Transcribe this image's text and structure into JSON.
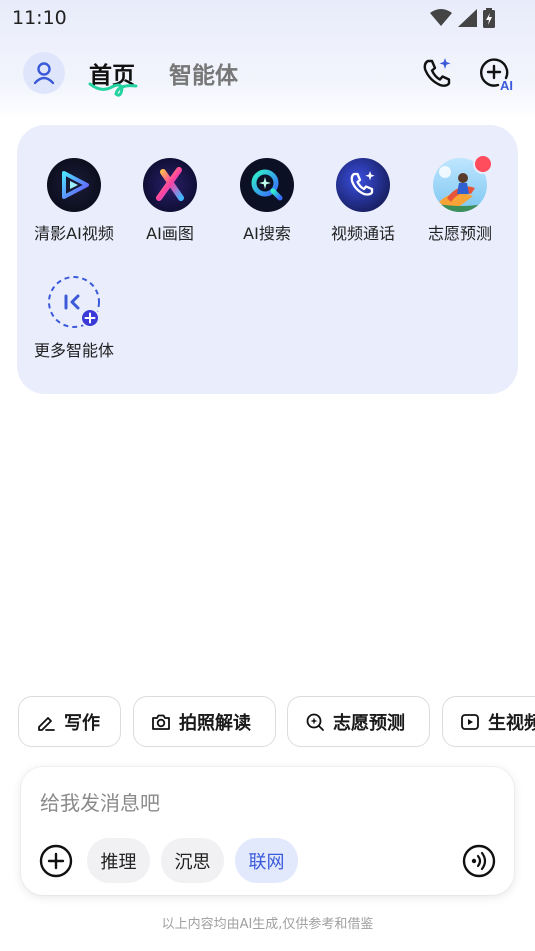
{
  "status_bar": {
    "time": "11:10"
  },
  "header": {
    "tab_home": "首页",
    "tab_agents": "智能体"
  },
  "agents": [
    {
      "label": "清影AI视频"
    },
    {
      "label": "AI画图"
    },
    {
      "label": "AI搜索"
    },
    {
      "label": "视频通话"
    },
    {
      "label": "志愿预测"
    },
    {
      "label": "更多智能体"
    }
  ],
  "chips": [
    {
      "label": "写作",
      "icon": "pen-icon"
    },
    {
      "label": "拍照解读",
      "icon": "camera-icon"
    },
    {
      "label": "志愿预测",
      "icon": "sparkle-search-icon"
    },
    {
      "label": "生视频",
      "icon": "play-icon"
    }
  ],
  "composer": {
    "placeholder": "给我发消息吧",
    "pills": [
      {
        "label": "推理",
        "active": false
      },
      {
        "label": "沉思",
        "active": false
      },
      {
        "label": "联网",
        "active": true
      }
    ]
  },
  "disclaimer": "以上内容均由AI生成,仅供参考和借鉴",
  "colors": {
    "accent": "#3a5ad9",
    "panel": "#eaedfc",
    "hot_badge": "#ff4d5e"
  }
}
